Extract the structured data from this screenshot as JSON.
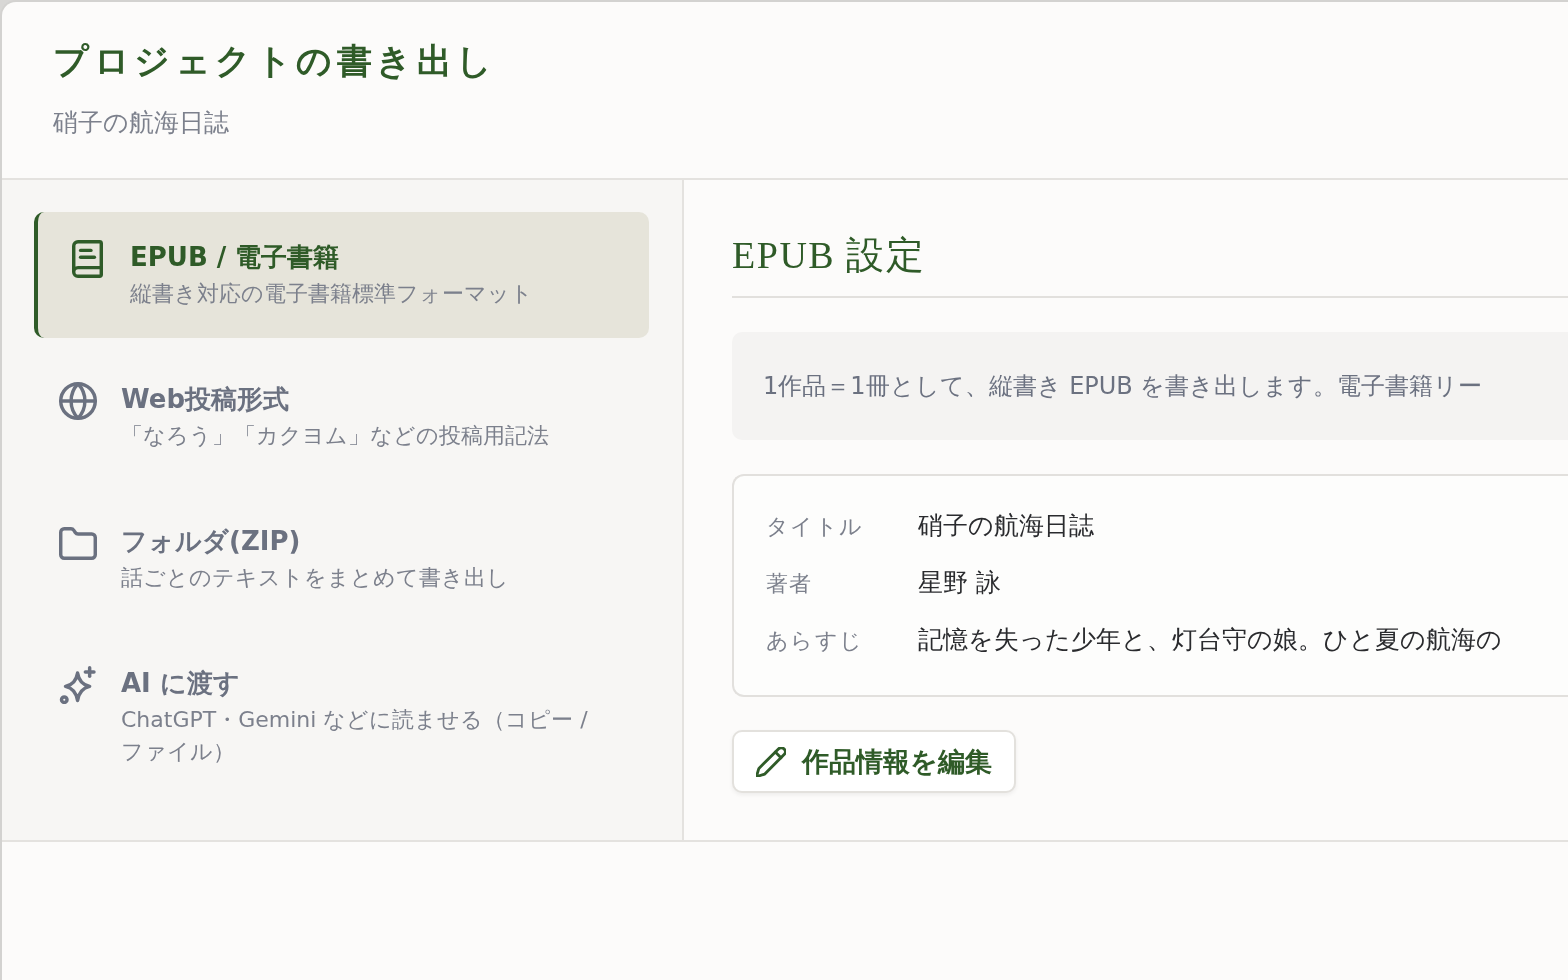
{
  "dialog": {
    "title": "プロジェクトの書き出し",
    "subtitle": "硝子の航海日誌"
  },
  "formats": [
    {
      "kind": "epub",
      "label": "EPUB / 電子書籍",
      "description": "縦書き対応の電子書籍標準フォーマット",
      "selected": true
    },
    {
      "kind": "web",
      "label": "Web投稿形式",
      "description": "「なろう」「カクヨム」などの投稿用記法",
      "selected": false
    },
    {
      "kind": "folder",
      "label": "フォルダ(ZIP)",
      "description": "話ごとのテキストをまとめて書き出し",
      "selected": false
    },
    {
      "kind": "ai",
      "label": "AI に渡す",
      "description": "ChatGPT・Gemini などに読ませる（コピー / ファイル）",
      "selected": false
    }
  ],
  "panel": {
    "heading": "EPUB 設定",
    "info": "1作品＝1冊として、縦書き EPUB を書き出します。電子書籍リー",
    "metadata": [
      {
        "label": "タイトル",
        "value": "硝子の航海日誌"
      },
      {
        "label": "著者",
        "value": "星野 詠"
      },
      {
        "label": "あらすじ",
        "value": "記憶を失った少年と、灯台守の娘。ひと夏の航海の"
      }
    ],
    "edit_button": "作品情報を編集"
  }
}
